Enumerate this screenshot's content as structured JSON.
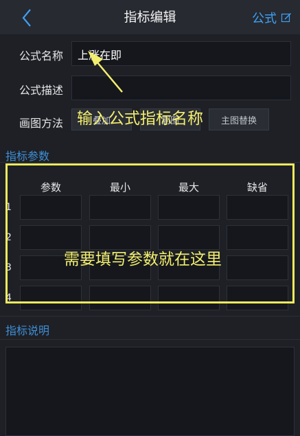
{
  "header": {
    "title": "指标编辑",
    "formula_label": "公式"
  },
  "form": {
    "name_label": "公式名称",
    "name_value": "上涨在即",
    "desc_label": "公式描述",
    "desc_value": "",
    "draw_label": "画图方法",
    "draw_buttons": [
      "叠加",
      "副图",
      "主图替换"
    ]
  },
  "params": {
    "title": "指标参数",
    "columns": [
      "参数",
      "最小",
      "最大",
      "缺省"
    ],
    "rows": [
      "1",
      "2",
      "3",
      "4"
    ]
  },
  "description": {
    "title": "指标说明"
  },
  "annotations": {
    "name_hint": "输入公式指标名称",
    "params_hint": "需要填写参数就在这里"
  },
  "colors": {
    "accent_blue": "#3fa0f5",
    "highlight_yellow": "#f2ec5e",
    "header_bg": "#272a31",
    "body_bg": "#1e2026"
  }
}
